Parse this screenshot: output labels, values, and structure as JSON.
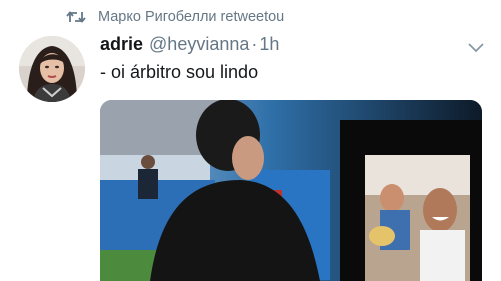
{
  "retweet": {
    "icon": "retweet-icon",
    "text": "Марко Ригобелли retweetou"
  },
  "author": {
    "display_name": "adrie",
    "handle": "@heyvianna",
    "separator": "·",
    "time": "1h",
    "avatar_icon": "avatar"
  },
  "tweet": {
    "text": "- oi árbitro sou lindo"
  },
  "menu": {
    "icon": "chevron-down-icon"
  },
  "colors": {
    "text_primary": "#14171a",
    "text_secondary": "#657786",
    "background": "#ffffff"
  }
}
